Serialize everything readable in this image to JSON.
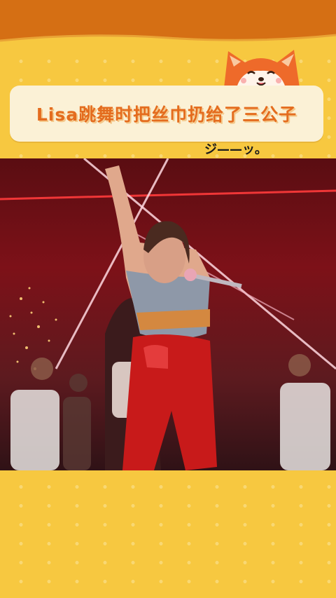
{
  "header": {
    "title": "Lisa跳舞时把丝巾扔给了三公子",
    "scribble_text": "ジ——ッ。"
  },
  "colors": {
    "band": "#d56f14",
    "background": "#f7c840",
    "card": "#fbf1d6",
    "title": "#e46c1e",
    "video_red": "#7d1118"
  },
  "video": {
    "scene": "stage-performance-frame"
  }
}
